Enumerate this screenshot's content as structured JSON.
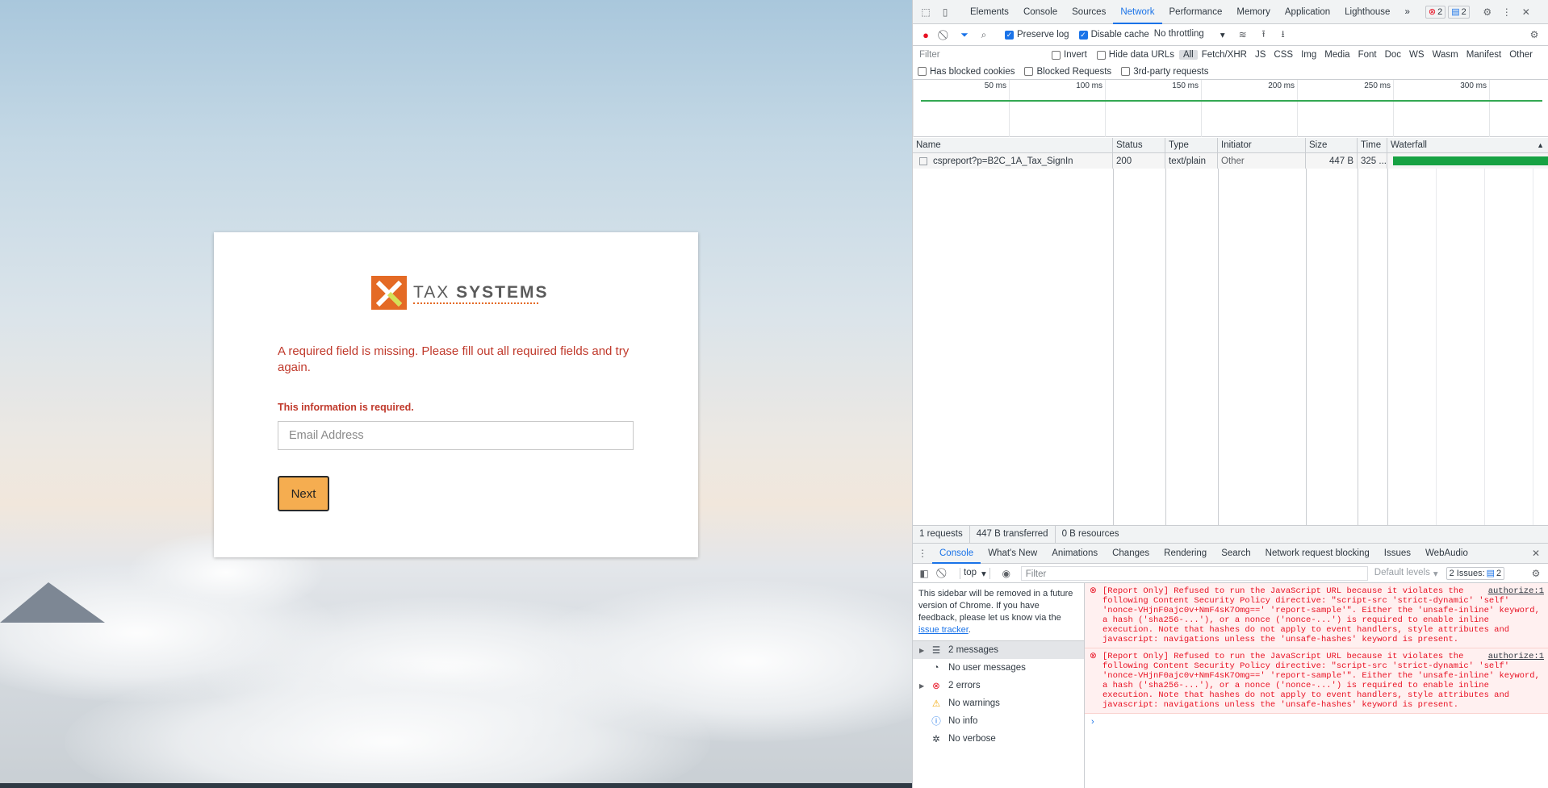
{
  "page": {
    "logo": {
      "word1": "TAX",
      "word2": "SYSTEMS"
    },
    "error_message": "A required field is missing. Please fill out all required fields and try again.",
    "field_error": "This information is required.",
    "email_placeholder": "Email Address",
    "next_label": "Next"
  },
  "devtools": {
    "tabs": [
      "Elements",
      "Console",
      "Sources",
      "Network",
      "Performance",
      "Memory",
      "Application",
      "Lighthouse"
    ],
    "active_tab": "Network",
    "more_tabs": "»",
    "error_count": "2",
    "issue_count": "2",
    "toolbar": {
      "preserve_log": "Preserve log",
      "disable_cache": "Disable cache",
      "throttling": "No throttling"
    },
    "filter": {
      "placeholder": "Filter",
      "invert": "Invert",
      "hide_data_urls": "Hide data URLs",
      "types": [
        "All",
        "Fetch/XHR",
        "JS",
        "CSS",
        "Img",
        "Media",
        "Font",
        "Doc",
        "WS",
        "Wasm",
        "Manifest",
        "Other"
      ]
    },
    "blocked": {
      "has_blocked_cookies": "Has blocked cookies",
      "blocked_requests": "Blocked Requests",
      "third_party": "3rd-party requests"
    },
    "timeline_ticks": [
      "50 ms",
      "100 ms",
      "150 ms",
      "200 ms",
      "250 ms",
      "300 ms"
    ],
    "table": {
      "headers": {
        "name": "Name",
        "status": "Status",
        "type": "Type",
        "initiator": "Initiator",
        "size": "Size",
        "time": "Time",
        "waterfall": "Waterfall"
      },
      "row": {
        "name": "cspreport?p=B2C_1A_Tax_SignIn",
        "status": "200",
        "type": "text/plain",
        "initiator": "Other",
        "size": "447 B",
        "time": "325 ..."
      }
    },
    "summary": {
      "requests": "1 requests",
      "transferred": "447 B transferred",
      "resources": "0 B resources"
    },
    "drawer_tabs": [
      "Console",
      "What's New",
      "Animations",
      "Changes",
      "Rendering",
      "Search",
      "Network request blocking",
      "Issues",
      "WebAudio"
    ],
    "console": {
      "context": "top",
      "filter_placeholder": "Filter",
      "levels": "Default levels",
      "issues_label": "2 Issues:",
      "issues_count": "2",
      "sidebar_note": "This sidebar will be removed in a future version of Chrome. If you have feedback, please let us know via the",
      "sidebar_link": "issue tracker",
      "sidebar_items": [
        "2 messages",
        "No user messages",
        "2 errors",
        "No warnings",
        "No info",
        "No verbose"
      ],
      "messages": [
        {
          "text": "[Report Only] Refused to run the JavaScript URL because it violates the following Content Security Policy directive: \"script-src 'strict-dynamic' 'self' 'nonce-VHjnF0ajc0v+NmF4sK7Omg=='  'report-sample'\". Either the 'unsafe-inline' keyword, a hash ('sha256-...'), or a nonce ('nonce-...') is required to enable inline execution. Note that hashes do not apply to event handlers, style attributes and javascript: navigations unless the 'unsafe-hashes' keyword is present.",
          "source": "authorize:1"
        },
        {
          "text": "[Report Only] Refused to run the JavaScript URL because it violates the following Content Security Policy directive: \"script-src 'strict-dynamic' 'self' 'nonce-VHjnF0ajc0v+NmF4sK7Omg=='  'report-sample'\". Either the 'unsafe-inline' keyword, a hash ('sha256-...'), or a nonce ('nonce-...') is required to enable inline execution. Note that hashes do not apply to event handlers, style attributes and javascript: navigations unless the 'unsafe-hashes' keyword is present.",
          "source": "authorize:1"
        }
      ],
      "prompt": "›"
    }
  },
  "colors": {
    "brand": "#e46a25",
    "button": "#f5ad50",
    "error": "#c0392b",
    "accent": "#1a73e8"
  }
}
